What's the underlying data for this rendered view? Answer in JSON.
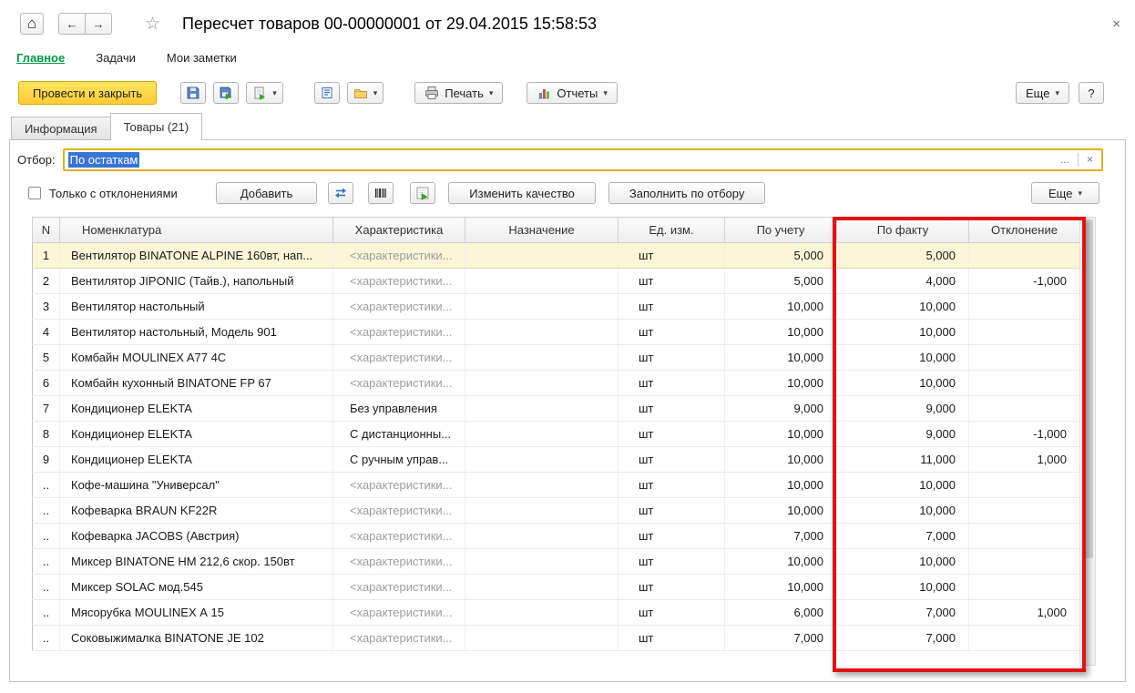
{
  "window": {
    "title": "Пересчет товаров 00-00000001 от 29.04.2015 15:58:53",
    "close_glyph": "×"
  },
  "nav": {
    "home_glyph": "⌂",
    "back_glyph": "←",
    "forward_glyph": "→",
    "star_glyph": "☆"
  },
  "menu": {
    "items": [
      {
        "label": "Главное",
        "active": true
      },
      {
        "label": "Задачи",
        "active": false
      },
      {
        "label": "Мои заметки",
        "active": false
      }
    ]
  },
  "toolbar": {
    "post_and_close": "Провести и закрыть",
    "print_label": "Печать",
    "reports_label": "Отчеты",
    "more_label": "Еще",
    "help_label": "?",
    "dropdown_glyph": "▾"
  },
  "tabs": [
    {
      "label": "Информация",
      "active": false
    },
    {
      "label": "Товары (21)",
      "active": true
    }
  ],
  "filter": {
    "label": "Отбор:",
    "value": "По остаткам",
    "choose_glyph": "...",
    "clear_glyph": "×"
  },
  "list_toolbar": {
    "only_deviations_label": "Только с отклонениями",
    "checkbox_checked": false,
    "add_label": "Добавить",
    "change_quality_label": "Изменить качество",
    "fill_by_selection_label": "Заполнить по отбору",
    "more_label": "Еще"
  },
  "table": {
    "columns": [
      "N",
      "Номенклатура",
      "Характеристика",
      "Назначение",
      "Ед. изм.",
      "По учету",
      "По факту",
      "Отклонение"
    ],
    "rows": [
      {
        "n": "1",
        "name": "Вентилятор BINATONE ALPINE 160вт, нап...",
        "characteristic": "<характеристики...",
        "characteristic_gray": true,
        "purpose": "",
        "unit": "шт",
        "by_account": "5,000",
        "by_fact": "5,000",
        "deviation": "",
        "selected": true
      },
      {
        "n": "2",
        "name": "Вентилятор JIPONIC (Тайв.), напольный",
        "characteristic": "<характеристики...",
        "characteristic_gray": true,
        "purpose": "",
        "unit": "шт",
        "by_account": "5,000",
        "by_fact": "4,000",
        "deviation": "-1,000"
      },
      {
        "n": "3",
        "name": "Вентилятор настольный",
        "characteristic": "<характеристики...",
        "characteristic_gray": true,
        "purpose": "",
        "unit": "шт",
        "by_account": "10,000",
        "by_fact": "10,000",
        "deviation": ""
      },
      {
        "n": "4",
        "name": "Вентилятор настольный, Модель 901",
        "characteristic": "<характеристики...",
        "characteristic_gray": true,
        "purpose": "",
        "unit": "шт",
        "by_account": "10,000",
        "by_fact": "10,000",
        "deviation": ""
      },
      {
        "n": "5",
        "name": "Комбайн MOULINEX  A77 4C",
        "characteristic": "<характеристики...",
        "characteristic_gray": true,
        "purpose": "",
        "unit": "шт",
        "by_account": "10,000",
        "by_fact": "10,000",
        "deviation": ""
      },
      {
        "n": "6",
        "name": "Комбайн кухонный BINATONE FP 67",
        "characteristic": "<характеристики...",
        "characteristic_gray": true,
        "purpose": "",
        "unit": "шт",
        "by_account": "10,000",
        "by_fact": "10,000",
        "deviation": ""
      },
      {
        "n": "7",
        "name": "Кондиционер ELEKTA",
        "characteristic": "Без управления",
        "characteristic_gray": false,
        "purpose": "",
        "unit": "шт",
        "by_account": "9,000",
        "by_fact": "9,000",
        "deviation": ""
      },
      {
        "n": "8",
        "name": "Кондиционер ELEKTA",
        "characteristic": "С дистанционны...",
        "characteristic_gray": false,
        "purpose": "",
        "unit": "шт",
        "by_account": "10,000",
        "by_fact": "9,000",
        "deviation": "-1,000"
      },
      {
        "n": "9",
        "name": "Кондиционер ELEKTA",
        "characteristic": "С ручным управ...",
        "characteristic_gray": false,
        "purpose": "",
        "unit": "шт",
        "by_account": "10,000",
        "by_fact": "11,000",
        "deviation": "1,000"
      },
      {
        "n": "..",
        "name": "Кофе-машина \"Универсал\"",
        "characteristic": "<характеристики...",
        "characteristic_gray": true,
        "purpose": "",
        "unit": "шт",
        "by_account": "10,000",
        "by_fact": "10,000",
        "deviation": ""
      },
      {
        "n": "..",
        "name": "Кофеварка BRAUN KF22R",
        "characteristic": "<характеристики...",
        "characteristic_gray": true,
        "purpose": "",
        "unit": "шт",
        "by_account": "10,000",
        "by_fact": "10,000",
        "deviation": ""
      },
      {
        "n": "..",
        "name": "Кофеварка JACOBS (Австрия)",
        "characteristic": "<характеристики...",
        "characteristic_gray": true,
        "purpose": "",
        "unit": "шт",
        "by_account": "7,000",
        "by_fact": "7,000",
        "deviation": ""
      },
      {
        "n": "..",
        "name": "Миксер BINATONE HM 212,6 скор. 150вт",
        "characteristic": "<характеристики...",
        "characteristic_gray": true,
        "purpose": "",
        "unit": "шт",
        "by_account": "10,000",
        "by_fact": "10,000",
        "deviation": ""
      },
      {
        "n": "..",
        "name": "Миксер SOLAC мод.545",
        "characteristic": "<характеристики...",
        "characteristic_gray": true,
        "purpose": "",
        "unit": "шт",
        "by_account": "10,000",
        "by_fact": "10,000",
        "deviation": ""
      },
      {
        "n": "..",
        "name": "Мясорубка MOULINEX  А 15",
        "characteristic": "<характеристики...",
        "characteristic_gray": true,
        "purpose": "",
        "unit": "шт",
        "by_account": "6,000",
        "by_fact": "7,000",
        "deviation": "1,000"
      },
      {
        "n": "..",
        "name": "Соковыжималка  BINATONE JE 102",
        "characteristic": "<характеристики...",
        "characteristic_gray": true,
        "purpose": "",
        "unit": "шт",
        "by_account": "7,000",
        "by_fact": "7,000",
        "deviation": ""
      }
    ]
  },
  "colors": {
    "accent_yellow": "#ffd84a",
    "menu_green": "#009a44",
    "selection_blue": "#3875d7",
    "annotation_red": "#e11212",
    "selected_row": "#fcf5d8"
  },
  "icons": {
    "save-icon": "floppy-disk",
    "post-icon": "floppy-disk-green-arrow",
    "create-based-on-icon": "document-green-arrow",
    "document-structure-icon": "blue-document-lines",
    "attachments-icon": "folder",
    "printer-icon": "printer",
    "bar-chart-icon": "colored-bars",
    "swap-arrows-icon": "blue-arrows",
    "barcode-icon": "barcode",
    "fill-arrow-icon": "green-arrow"
  }
}
